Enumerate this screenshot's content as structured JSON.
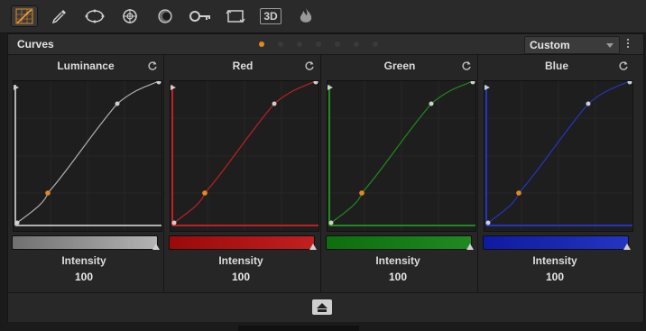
{
  "toolbar": {
    "tools": [
      {
        "icon": "curves-icon",
        "active": true
      },
      {
        "icon": "eyedropper-icon",
        "active": false
      },
      {
        "icon": "window-icon",
        "active": false
      },
      {
        "icon": "tracker-icon",
        "active": false
      },
      {
        "icon": "blur-icon",
        "active": false
      },
      {
        "icon": "key-icon",
        "active": false
      },
      {
        "icon": "sizing-icon",
        "active": false
      },
      {
        "icon": "3d-icon",
        "active": false,
        "label": "3D"
      },
      {
        "icon": "fx-icon",
        "active": false
      }
    ]
  },
  "panel": {
    "title": "Curves",
    "page_dots": 7,
    "active_dot": 0,
    "preset": "Custom"
  },
  "channels": [
    {
      "name": "Luminance",
      "color": "#b0b0b0",
      "bar_color": "#7a7a7a",
      "intensity_label": "Intensity",
      "intensity": "100"
    },
    {
      "name": "Red",
      "color": "#c02020",
      "bar_color": "#9a0a0a",
      "intensity_label": "Intensity",
      "intensity": "100"
    },
    {
      "name": "Green",
      "color": "#1f8a1f",
      "bar_color": "#0d6e0d",
      "intensity_label": "Intensity",
      "intensity": "100"
    },
    {
      "name": "Blue",
      "color": "#2535c0",
      "bar_color": "#0e1aa0",
      "intensity_label": "Intensity",
      "intensity": "100"
    }
  ],
  "colors": {
    "accent": "#e5891e",
    "control_point": "#cfcfcf"
  }
}
